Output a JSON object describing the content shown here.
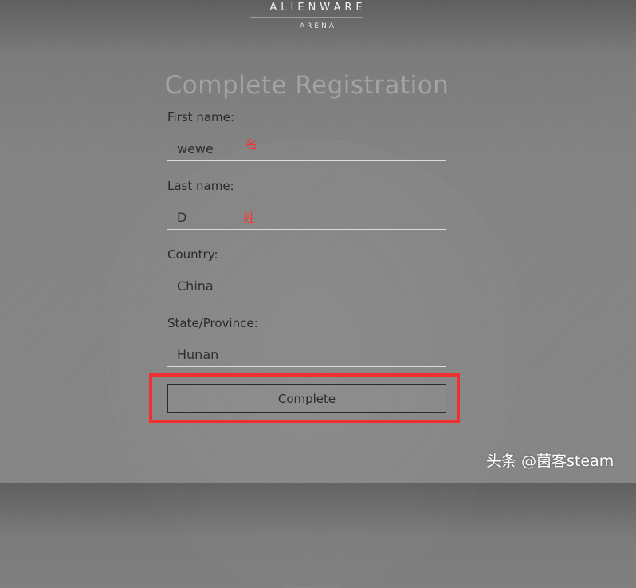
{
  "brand": {
    "name": "ALIENWARE",
    "sub": "ARENA"
  },
  "title": "Complete Registration",
  "form": {
    "first_name": {
      "label": "First name:",
      "value": "wewe",
      "annotation": "名"
    },
    "last_name": {
      "label": "Last name:",
      "value": "D",
      "annotation": "姓"
    },
    "country": {
      "label": "Country:",
      "value": "China"
    },
    "state": {
      "label": "State/Province:",
      "value": "Hunan"
    }
  },
  "buttons": {
    "complete": "Complete"
  },
  "watermark": "头条 @菌客steam",
  "colors": {
    "highlight": "#ee3030",
    "annotation": "#ff3030"
  }
}
